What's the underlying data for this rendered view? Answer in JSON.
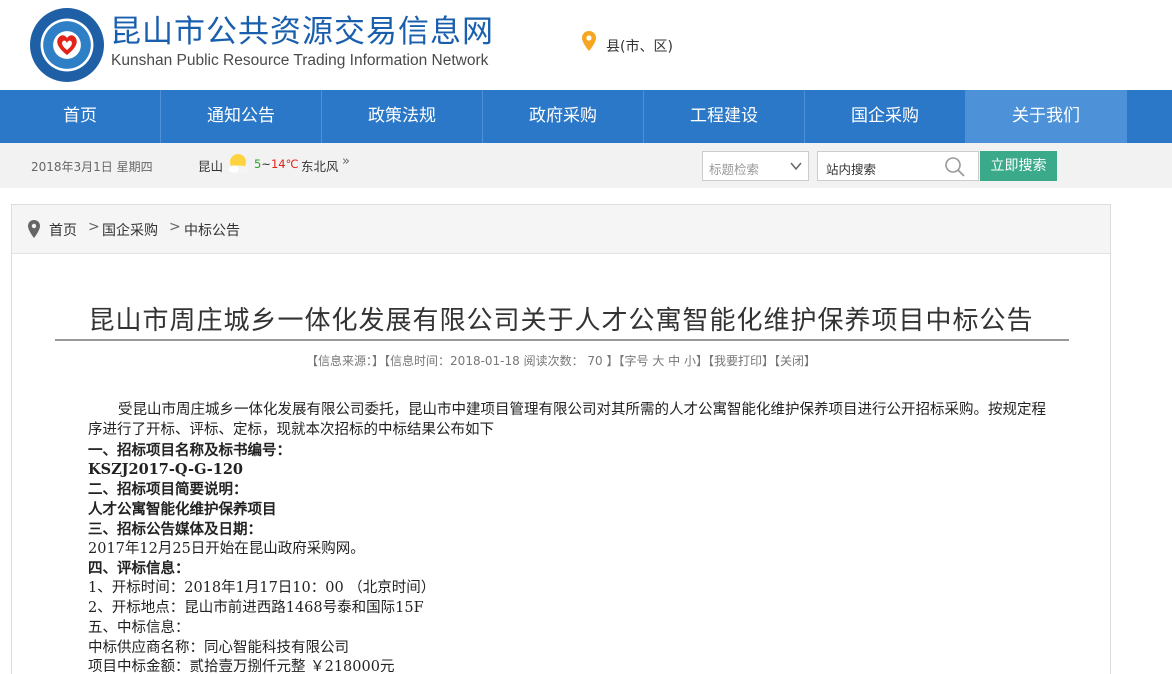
{
  "header": {
    "title_cn": "昆山市公共资源交易信息网",
    "title_en": "Kunshan Public Resource Trading Information Network",
    "location_label": "县(市、区)"
  },
  "nav": {
    "items": [
      "首页",
      "通知公告",
      "政策法规",
      "政府采购",
      "工程建设",
      "国企采购",
      "关于我们"
    ],
    "active_index": 6
  },
  "infobar": {
    "date": "2018年3月1日  星期四",
    "city": "昆山",
    "temp_low": "5",
    "temp_sep": "~",
    "temp_high": "14℃",
    "wind": "东北风",
    "more": "»"
  },
  "search": {
    "select_value": "标题检索",
    "input_placeholder": "站内搜索",
    "button_label": "立即搜索"
  },
  "breadcrumb": {
    "items": [
      "首页",
      "国企采购",
      "中标公告"
    ],
    "separator": ">"
  },
  "article": {
    "title": "昆山市周庄城乡一体化发展有限公司关于人才公寓智能化维护保养项目中标公告",
    "meta": "【信息来源：】【信息时间：2018-01-18  阅读次数：  70  】【字号  大  中  小】【我要打印】【关闭】",
    "lines": [
      "受昆山市周庄城乡一体化发展有限公司委托，昆山市中建项目管理有限公司对其所需的人才公寓智能化维护保养项目进行公开招标采购。按规定程序进行了开标、评标、定标，现就本次招标的中标结果公布如下",
      "一、招标项目名称及标书编号：",
      "KSZJ2017-Q-G-120",
      "二、招标项目简要说明：",
      "人才公寓智能化维护保养项目",
      "三、招标公告媒体及日期：",
      "2017年12月25日开始在昆山政府采购网。",
      "四、评标信息：",
      "1、开标时间：2018年1月17日10：00 （北京时间）",
      "2、开标地点：昆山市前进西路1468号泰和国际15F",
      "五、中标信息：",
      "中标供应商名称：同心智能科技有限公司",
      "项目中标金额：贰拾壹万捌仟元整     ￥218000元"
    ]
  },
  "colors": {
    "nav_bg": "#2b78c8",
    "nav_active": "#4d92d8",
    "title_blue": "#1a5fae",
    "search_btn": "#3aaa8a",
    "temp_low": "#2aa52a",
    "temp_high": "#e2231a"
  },
  "icons": {
    "logo": "kunshan-emblem",
    "location": "map-pin-icon",
    "weather": "sun-cloud-icon",
    "dropdown": "chevron-down-icon",
    "search": "search-icon",
    "breadcrumb": "map-pin-icon"
  }
}
